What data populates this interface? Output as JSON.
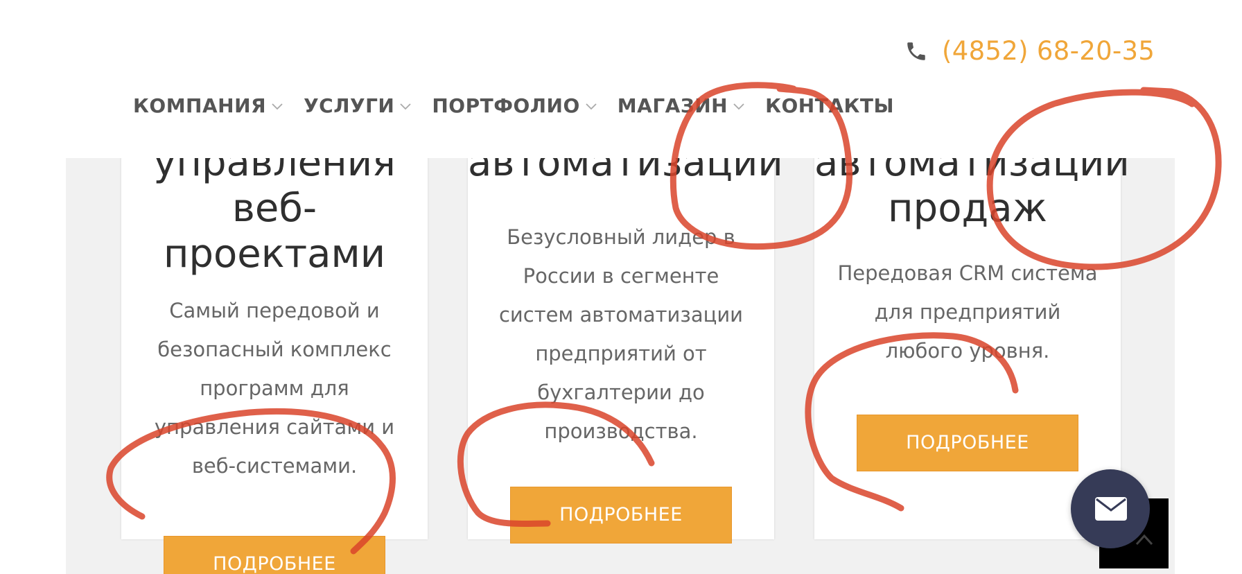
{
  "header": {
    "phone": {
      "icon": "phone-icon",
      "number": "(4852) 68-20-35"
    },
    "nav": [
      {
        "label": "КОМПАНИЯ",
        "has_dropdown": true
      },
      {
        "label": "УСЛУГИ",
        "has_dropdown": true
      },
      {
        "label": "ПОРТФОЛИО",
        "has_dropdown": true
      },
      {
        "label": "МАГАЗИН",
        "has_dropdown": true
      },
      {
        "label": "КОНТАКТЫ",
        "has_dropdown": false
      }
    ]
  },
  "cards": [
    {
      "title_lines": [
        "управления",
        "веб-",
        "проектами"
      ],
      "description_lines": [
        "Самый передовой и",
        "безопасный комплекс",
        "программ для",
        "управления сайтами и",
        "веб-системами."
      ],
      "button": "ПОДРОБНЕЕ"
    },
    {
      "title_lines": [
        "автоматизации"
      ],
      "description_lines": [
        "Безусловный лидер в",
        "России в сегменте",
        "систем автоматизации",
        "предприятий от",
        "бухгалтерии до",
        "производства."
      ],
      "button": "ПОДРОБНЕЕ"
    },
    {
      "title_lines": [
        "автоматизации",
        "продаж"
      ],
      "description_lines": [
        "Передовая CRM система",
        "для предприятий",
        "любого уровня."
      ],
      "button": "ПОДРОБНЕЕ"
    }
  ],
  "widgets": {
    "chat_button_icon": "envelope-icon",
    "scroll_top_icon": "chevron-up-icon"
  },
  "colors": {
    "accent": "#f0a639",
    "nav_text": "#555555",
    "fab_bg": "#363b57",
    "annotation": "#d9442a"
  }
}
